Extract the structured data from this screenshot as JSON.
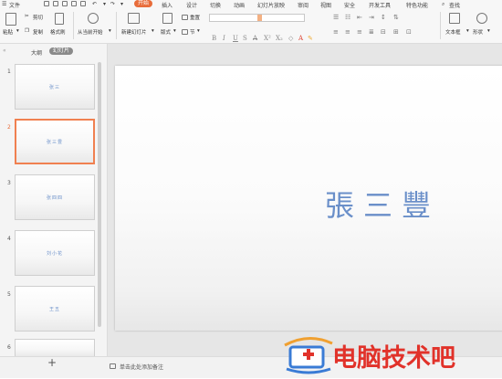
{
  "menubar": {
    "app_menu": "文件",
    "tabs": [
      "开始",
      "插入",
      "设计",
      "切换",
      "动画",
      "幻灯片放映",
      "审阅",
      "视图",
      "安全",
      "开发工具",
      "特色功能"
    ],
    "active_tab": "开始",
    "search_label": "查找"
  },
  "ribbon": {
    "paste": "粘贴",
    "cut": "剪切",
    "copy": "复制",
    "format_painter": "格式刷",
    "play_from_current": "从当前开始",
    "new_slide": "新建幻灯片",
    "layout": "版式",
    "reset": "重置",
    "section": "节",
    "text_box": "文本框",
    "shape": "形状"
  },
  "left_pane": {
    "tab_outline": "大纲",
    "tab_slides": "幻灯片",
    "add_slide": "+",
    "slides": [
      {
        "number": "1",
        "text": "张三",
        "selected": false
      },
      {
        "number": "2",
        "text": "张三豊",
        "selected": true
      },
      {
        "number": "3",
        "text": "张四四",
        "selected": false
      },
      {
        "number": "4",
        "text": "刘小花",
        "selected": false
      },
      {
        "number": "5",
        "text": "王五",
        "selected": false
      },
      {
        "number": "6",
        "text": "",
        "selected": false
      }
    ]
  },
  "main": {
    "slide_title": "張三豐"
  },
  "notes": {
    "placeholder": "单击此处添加备注"
  },
  "watermark": {
    "text": "电脑技术吧"
  },
  "colors": {
    "accent": "#e86c3a",
    "slide_text": "#6a8fc9",
    "watermark": "#e1322a"
  }
}
